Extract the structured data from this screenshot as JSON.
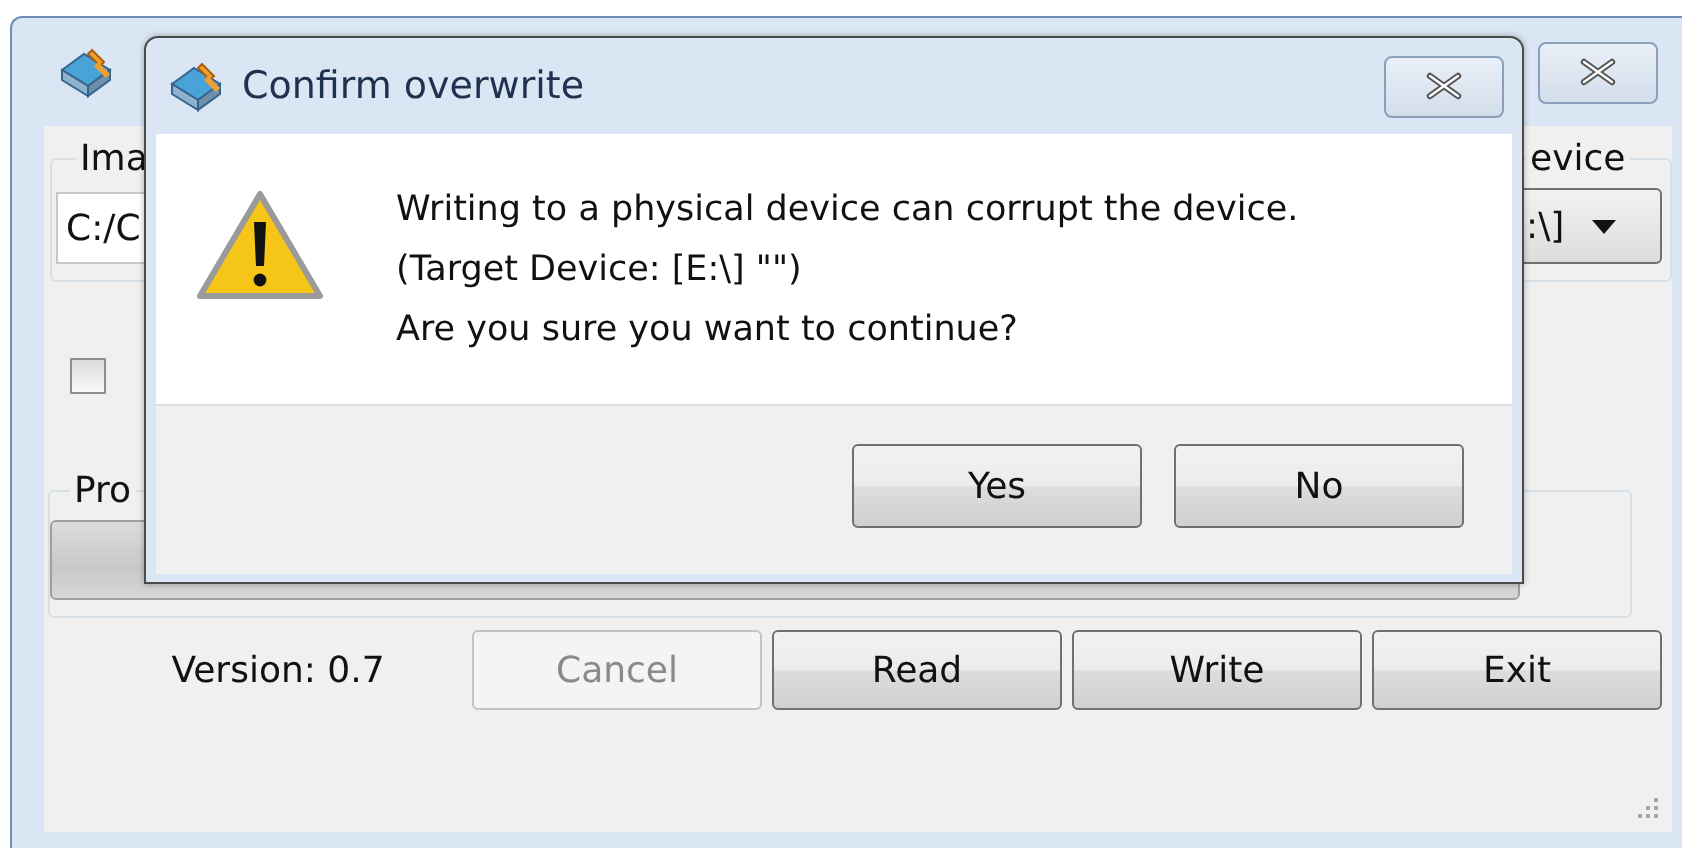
{
  "main_window": {
    "image_group": {
      "label": "Ima",
      "path": "C:/C"
    },
    "device_group": {
      "label": "evice",
      "device": ":\\]"
    },
    "checkbox": {
      "checked": false
    },
    "progress_group": {
      "label": "Pro",
      "level": 0
    },
    "version": "Version: 0.7",
    "buttons": [
      {
        "label": "Cancel",
        "disabled": true
      },
      {
        "label": "Read",
        "disabled": false
      },
      {
        "label": "Write",
        "disabled": false
      },
      {
        "label": "Exit",
        "disabled": false
      }
    ]
  },
  "dialog": {
    "title": "Confirm overwrite",
    "message": "Writing to a physical device can corrupt the device.\n(Target Device: [E:\\] \"\")\nAre you sure you want to continue?",
    "buttons": [
      {
        "label": "Yes"
      },
      {
        "label": "No"
      }
    ]
  }
}
